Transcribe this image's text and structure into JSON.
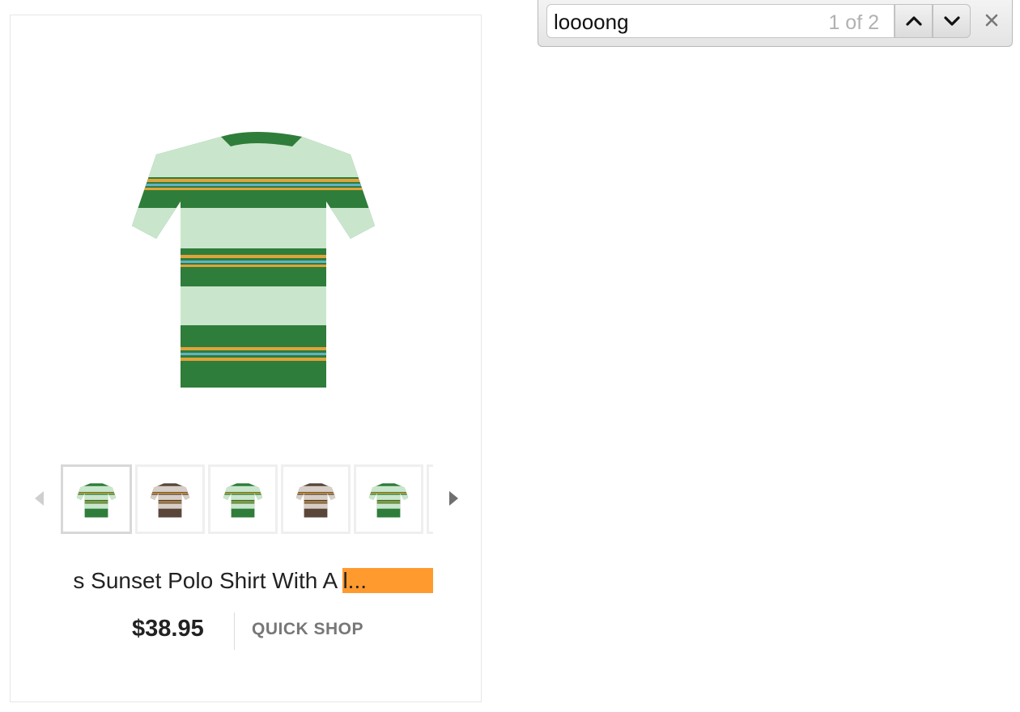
{
  "find_bar": {
    "query": "loooong",
    "match_count": "1 of 2",
    "prev_icon": "chevron-up-icon",
    "next_icon": "chevron-down-icon",
    "close_icon": "close-icon"
  },
  "product": {
    "title_visible": "s Sunset Polo Shirt With A ",
    "title_highlight": "l...",
    "price": "$38.95",
    "quick_shop": "QUICK SHOP",
    "highlight_color": "#ff9a2e",
    "thumbnails": [
      {
        "color": "green",
        "selected": true
      },
      {
        "color": "brown",
        "selected": false
      },
      {
        "color": "green",
        "selected": false
      },
      {
        "color": "brown",
        "selected": false
      },
      {
        "color": "green",
        "selected": false
      },
      {
        "color": "brown",
        "selected": false
      }
    ]
  }
}
